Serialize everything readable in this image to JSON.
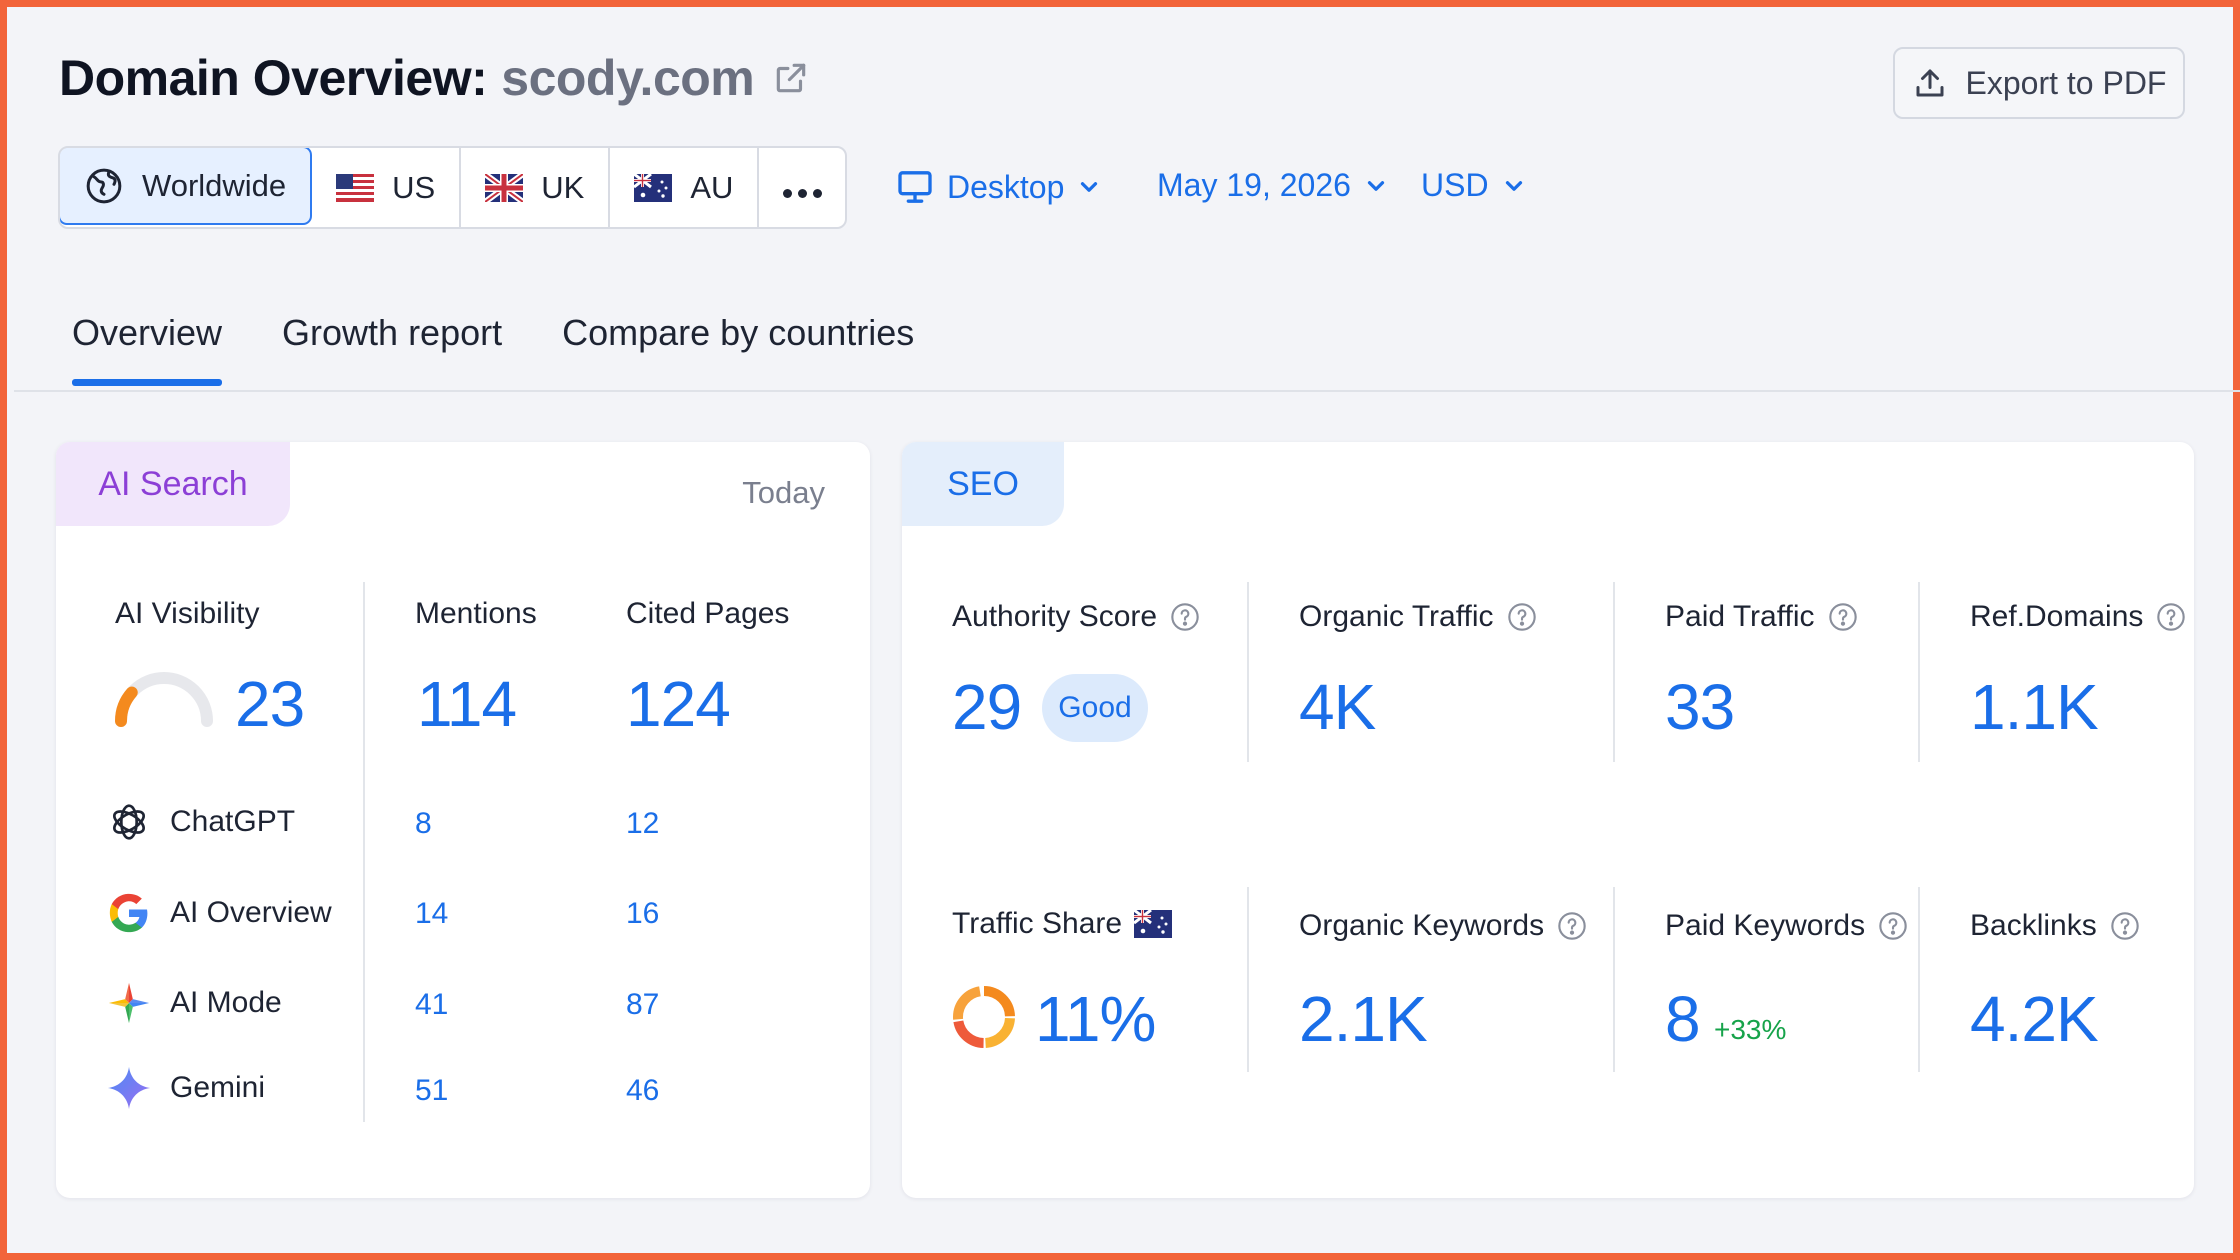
{
  "header": {
    "title": "Domain Overview:",
    "domain": "scody.com",
    "export_label": "Export to PDF"
  },
  "regions": [
    {
      "label": "Worldwide",
      "active": true
    },
    {
      "label": "US",
      "active": false
    },
    {
      "label": "UK",
      "active": false
    },
    {
      "label": "AU",
      "active": false
    }
  ],
  "filters": {
    "device": "Desktop",
    "date": "May 19, 2026",
    "currency": "USD"
  },
  "tabs": [
    {
      "label": "Overview",
      "active": true
    },
    {
      "label": "Growth report",
      "active": false
    },
    {
      "label": "Compare by countries",
      "active": false
    }
  ],
  "ai_search": {
    "chip": "AI Search",
    "period": "Today",
    "visibility_label": "AI Visibility",
    "visibility_value": "23",
    "visibility_gauge_fraction": 0.23,
    "mentions_label": "Mentions",
    "mentions_value": "114",
    "cited_label": "Cited Pages",
    "cited_value": "124",
    "engines": [
      {
        "name": "ChatGPT",
        "mentions": "8",
        "cited": "12",
        "icon": "chatgpt-icon"
      },
      {
        "name": "AI Overview",
        "mentions": "14",
        "cited": "16",
        "icon": "google-icon"
      },
      {
        "name": "AI Mode",
        "mentions": "41",
        "cited": "87",
        "icon": "ai-mode-icon"
      },
      {
        "name": "Gemini",
        "mentions": "51",
        "cited": "46",
        "icon": "gemini-icon"
      }
    ]
  },
  "seo": {
    "chip": "SEO",
    "authority": {
      "label": "Authority Score",
      "value": "29",
      "badge": "Good"
    },
    "organic_traffic": {
      "label": "Organic Traffic",
      "value": "4K"
    },
    "paid_traffic": {
      "label": "Paid Traffic",
      "value": "33"
    },
    "ref_domains": {
      "label": "Ref.Domains",
      "value": "1.1K"
    },
    "traffic_share": {
      "label": "Traffic Share",
      "value": "11%"
    },
    "organic_keywords": {
      "label": "Organic Keywords",
      "value": "2.1K"
    },
    "paid_keywords": {
      "label": "Paid Keywords",
      "value": "8",
      "delta": "+33%"
    },
    "backlinks": {
      "label": "Backlinks",
      "value": "4.2K"
    }
  },
  "colors": {
    "accent": "#1a6ee8",
    "frame": "#f2643a",
    "ai_chip": "#8c3fd6",
    "positive": "#16a34a"
  }
}
